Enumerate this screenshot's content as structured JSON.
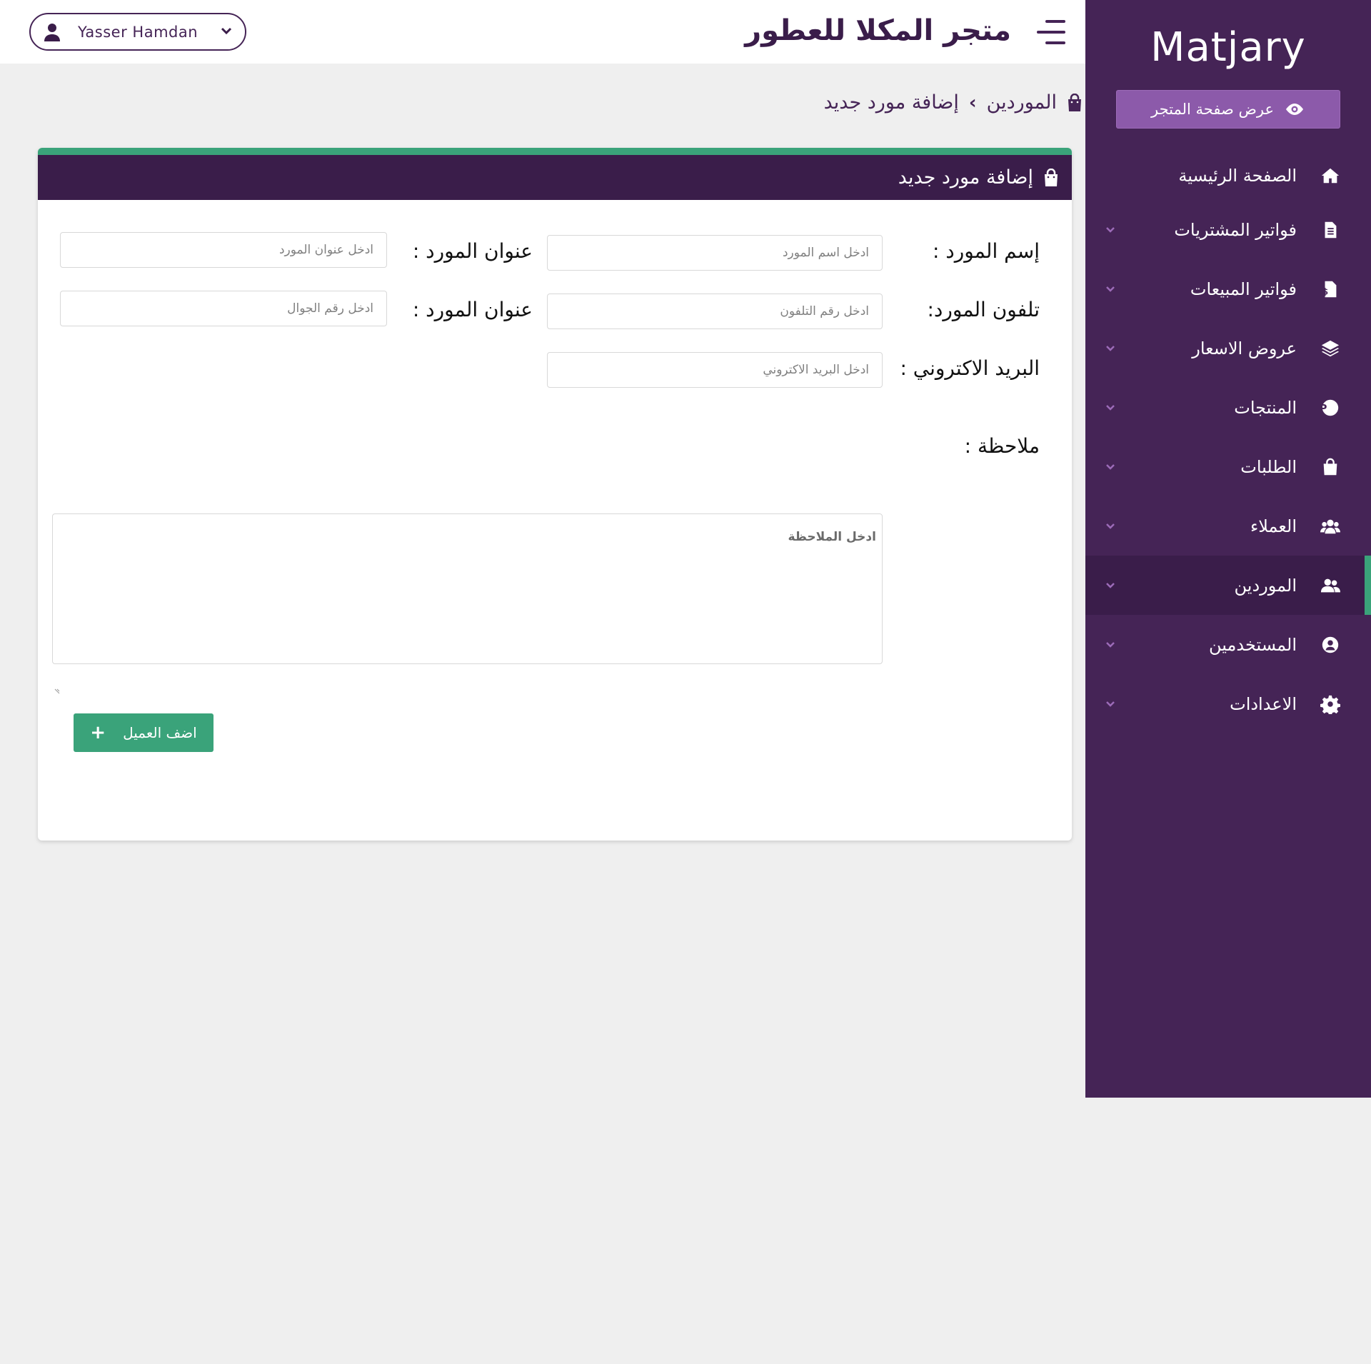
{
  "sidebar": {
    "brand": "Matjary",
    "store_button": "عرض صفحة المتجر",
    "items": [
      {
        "label": "الصفحة الرئيسية",
        "icon": "home-icon"
      },
      {
        "label": "فواتير المشتريات",
        "icon": "invoice-icon"
      },
      {
        "label": "فواتير المبيعات",
        "icon": "dollar-file-icon"
      },
      {
        "label": "عروض الاسعار",
        "icon": "layers-icon"
      },
      {
        "label": "المنتجات",
        "icon": "product-p-icon"
      },
      {
        "label": "الطلبات",
        "icon": "shopping-bag-icon"
      },
      {
        "label": "العملاء",
        "icon": "users-icon"
      },
      {
        "label": "الموردين",
        "icon": "user-friends-icon",
        "active": true
      },
      {
        "label": "المستخدمين",
        "icon": "user-circle-icon"
      },
      {
        "label": "الاعدادات",
        "icon": "gear-icon"
      }
    ]
  },
  "header": {
    "store_name": "متجر المكلا للعطور",
    "user_name": "Yasser Hamdan"
  },
  "breadcrumb": {
    "parent": "الموردين",
    "separator": "›",
    "current": "إضافة مورد جديد"
  },
  "form": {
    "title": "إضافة مورد جديد",
    "name_label": "إسم المورد :",
    "name_placeholder": "ادخل اسم المورد",
    "address_label": "عنوان المورد :",
    "address_placeholder": "ادخل عنوان المورد",
    "phone_label": "تلفون المورد:",
    "phone_placeholder": "ادخل رقم التلفون",
    "mobile_label": "عنوان المورد :",
    "mobile_placeholder": "ادخل رقم الجوال",
    "email_label": "البريد الاكتروني :",
    "email_placeholder": "ادخل البريد الاكتروني",
    "note_label": "ملاحظة :",
    "note_placeholder": "ادخل الملاحظة",
    "submit_label": "اضف العميل",
    "submit_icon": "+"
  },
  "colors": {
    "sidebar_bg": "#452456",
    "header_purple": "#3a1d4a",
    "accent_green": "#3aa37a",
    "store_button": "#8c5aaa"
  }
}
